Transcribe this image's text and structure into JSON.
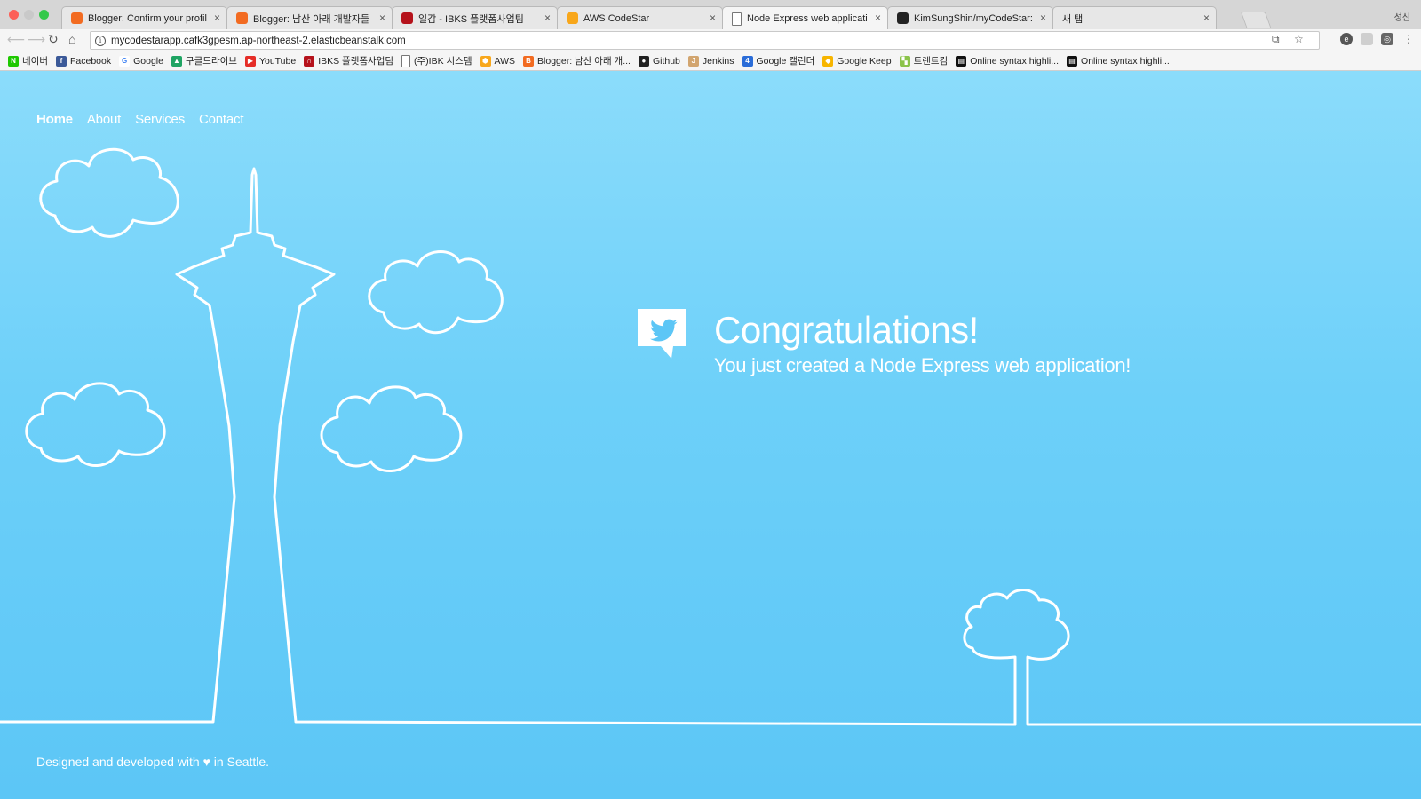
{
  "browser": {
    "tabs": [
      {
        "title": "Blogger: Confirm your profile",
        "favicon": "blogger-icon",
        "color": "#f26b21"
      },
      {
        "title": "Blogger: 남산 아래 개발자들 - 새 글",
        "favicon": "blogger-icon",
        "color": "#f26b21"
      },
      {
        "title": "일감 - IBKS 플랫폼사업팀",
        "favicon": "redmine-icon",
        "color": "#b5121b"
      },
      {
        "title": "AWS CodeStar",
        "favicon": "aws-codestar-icon",
        "color": "#f8a71b"
      },
      {
        "title": "Node Express web application",
        "favicon": "page-icon",
        "color": "#ffffff"
      },
      {
        "title": "KimSungShin/myCodeStar: AWS",
        "favicon": "github-icon",
        "color": "#222222"
      },
      {
        "title": "새 탭",
        "favicon": "none",
        "color": "#e7e7e7"
      }
    ],
    "active_tab": 4,
    "profile_name": "성신",
    "url": "mycodestarapp.cafk3gpesm.ap-northeast-2.elasticbeanstalk.com",
    "bookmarks": [
      {
        "label": "네이버",
        "icon": "naver-icon",
        "color": "#1ec800",
        "glyph": "N"
      },
      {
        "label": "Facebook",
        "icon": "facebook-icon",
        "color": "#3b5998",
        "glyph": "f"
      },
      {
        "label": "Google",
        "icon": "google-icon",
        "color": "#ffffff",
        "glyph": "G"
      },
      {
        "label": "구글드라이브",
        "icon": "google-drive-icon",
        "color": "#1fa463",
        "glyph": "▲"
      },
      {
        "label": "YouTube",
        "icon": "youtube-icon",
        "color": "#e52d27",
        "glyph": "▶"
      },
      {
        "label": "IBKS 플랫폼사업팀",
        "icon": "redmine-icon",
        "color": "#b5121b",
        "glyph": "∩"
      },
      {
        "label": "(주)IBK 시스템",
        "icon": "page-icon",
        "color": "#ffffff",
        "glyph": ""
      },
      {
        "label": "AWS",
        "icon": "aws-icon",
        "color": "#f8a71b",
        "glyph": "⬢"
      },
      {
        "label": "Blogger: 남산 아래 개...",
        "icon": "blogger-icon",
        "color": "#f26b21",
        "glyph": "B"
      },
      {
        "label": "Github",
        "icon": "github-icon",
        "color": "#222222",
        "glyph": "●"
      },
      {
        "label": "Jenkins",
        "icon": "jenkins-icon",
        "color": "#d2a56f",
        "glyph": "J"
      },
      {
        "label": "Google 캘린더",
        "icon": "google-calendar-icon",
        "color": "#2a6cd8",
        "glyph": "4"
      },
      {
        "label": "Google Keep",
        "icon": "google-keep-icon",
        "color": "#f7b500",
        "glyph": "◆"
      },
      {
        "label": "트렌트킴",
        "icon": "trend-icon",
        "color": "#8bc34a",
        "glyph": "▚"
      },
      {
        "label": "Online syntax highli...",
        "icon": "syntax-icon",
        "color": "#111111",
        "glyph": "▤"
      },
      {
        "label": "Online syntax highli...",
        "icon": "syntax-icon",
        "color": "#111111",
        "glyph": "▤"
      }
    ]
  },
  "page": {
    "nav": [
      "Home",
      "About",
      "Services",
      "Contact"
    ],
    "active_nav": "Home",
    "title": "Congratulations!",
    "subtitle": "You just created a Node Express web application!",
    "footer": "Designed and developed with ♥ in Seattle.",
    "icon": "twitter-bird-icon"
  },
  "colors": {
    "page_bg_top": "#8bdcfb",
    "page_bg_bottom": "#5cc6f6",
    "line_art": "#ffffff"
  }
}
